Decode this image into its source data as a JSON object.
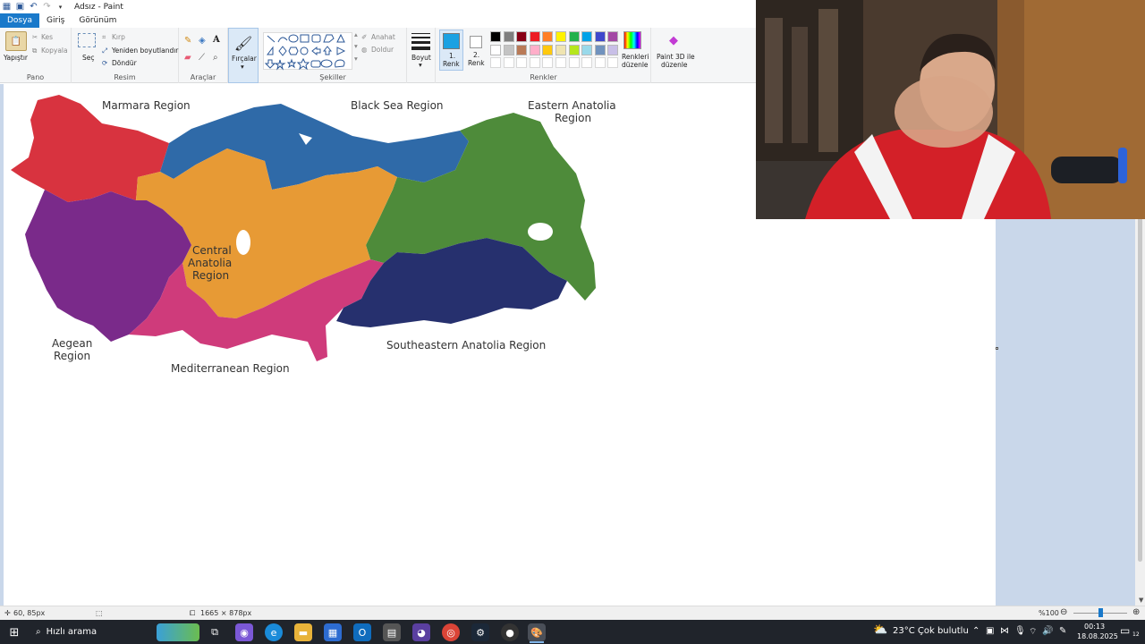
{
  "window": {
    "title": "Adsız - Paint"
  },
  "tabs": [
    {
      "label": "Dosya"
    },
    {
      "label": "Giriş"
    },
    {
      "label": "Görünüm"
    }
  ],
  "ribbon": {
    "pano": {
      "label": "Pano",
      "paste": "Yapıştır",
      "cut": "Kes",
      "copy": "Kopyala"
    },
    "resim": {
      "label": "Resim",
      "select": "Seç",
      "crop": "Kırp",
      "resize": "Yeniden boyutlandır",
      "rotate": "Döndür"
    },
    "araclar": {
      "label": "Araçlar"
    },
    "brushes": {
      "label": "Fırçalar"
    },
    "sekiller": {
      "label": "Şekiller",
      "outline": "Anahat",
      "fill": "Doldur"
    },
    "boyut": {
      "label": "Boyut"
    },
    "color1": {
      "label1": "1.",
      "label2": "Renk",
      "color": "#1ba1e2"
    },
    "color2": {
      "label1": "2.",
      "label2": "Renk",
      "color": "#ffffff"
    },
    "renkler": {
      "label": "Renkler",
      "edit": "Renkleri düzenle",
      "edit1": "Renkleri",
      "edit2": "düzenle"
    },
    "paint3d": {
      "line1": "Paint 3D ile",
      "line2": "düzenle"
    },
    "palette_row1": [
      "#000000",
      "#7f7f7f",
      "#880015",
      "#ed1c24",
      "#ff7f27",
      "#fff200",
      "#22b14c",
      "#00a2e8",
      "#3f48cc",
      "#a349a4"
    ],
    "palette_row2": [
      "#ffffff",
      "#c3c3c3",
      "#b97a57",
      "#ffaec9",
      "#ffc90e",
      "#efe4b0",
      "#b5e61d",
      "#99d9ea",
      "#7092be",
      "#c8bfe7"
    ]
  },
  "map": {
    "regions": [
      {
        "name": "Marmara Region",
        "color": "#d8333f"
      },
      {
        "name": "Black Sea Region",
        "color": "#2f6aa8"
      },
      {
        "name": "Eastern Anatolia Region",
        "color": "#4e8b3a"
      },
      {
        "name": "Central Anatolia Region",
        "color": "#e79a35"
      },
      {
        "name": "Aegean Region",
        "color": "#7a2a8a"
      },
      {
        "name": "Mediterranean Region",
        "color": "#cf3b7b"
      },
      {
        "name": "Southeastern Anatolia Region",
        "color": "#26306e"
      }
    ],
    "labels": {
      "marmara": "Marmara Region",
      "blacksea": "Black Sea Region",
      "eastern1": "Eastern Anatolia",
      "eastern2": "Region",
      "central1": "Central",
      "central2": "Anatolia",
      "central3": "Region",
      "aegean1": "Aegean",
      "aegean2": "Region",
      "mediterranean": "Mediterranean Region",
      "southeastern": "Southeastern Anatolia Region"
    }
  },
  "statusbar": {
    "cursor": "60, 85px",
    "dimensions": "1665 × 878px",
    "zoom": "%100"
  },
  "taskbar": {
    "search_placeholder": "Hızlı arama",
    "weather": "23°C  Çok bulutlu",
    "time": "00:13",
    "date": "18.08.2025",
    "notif_count": "12"
  }
}
